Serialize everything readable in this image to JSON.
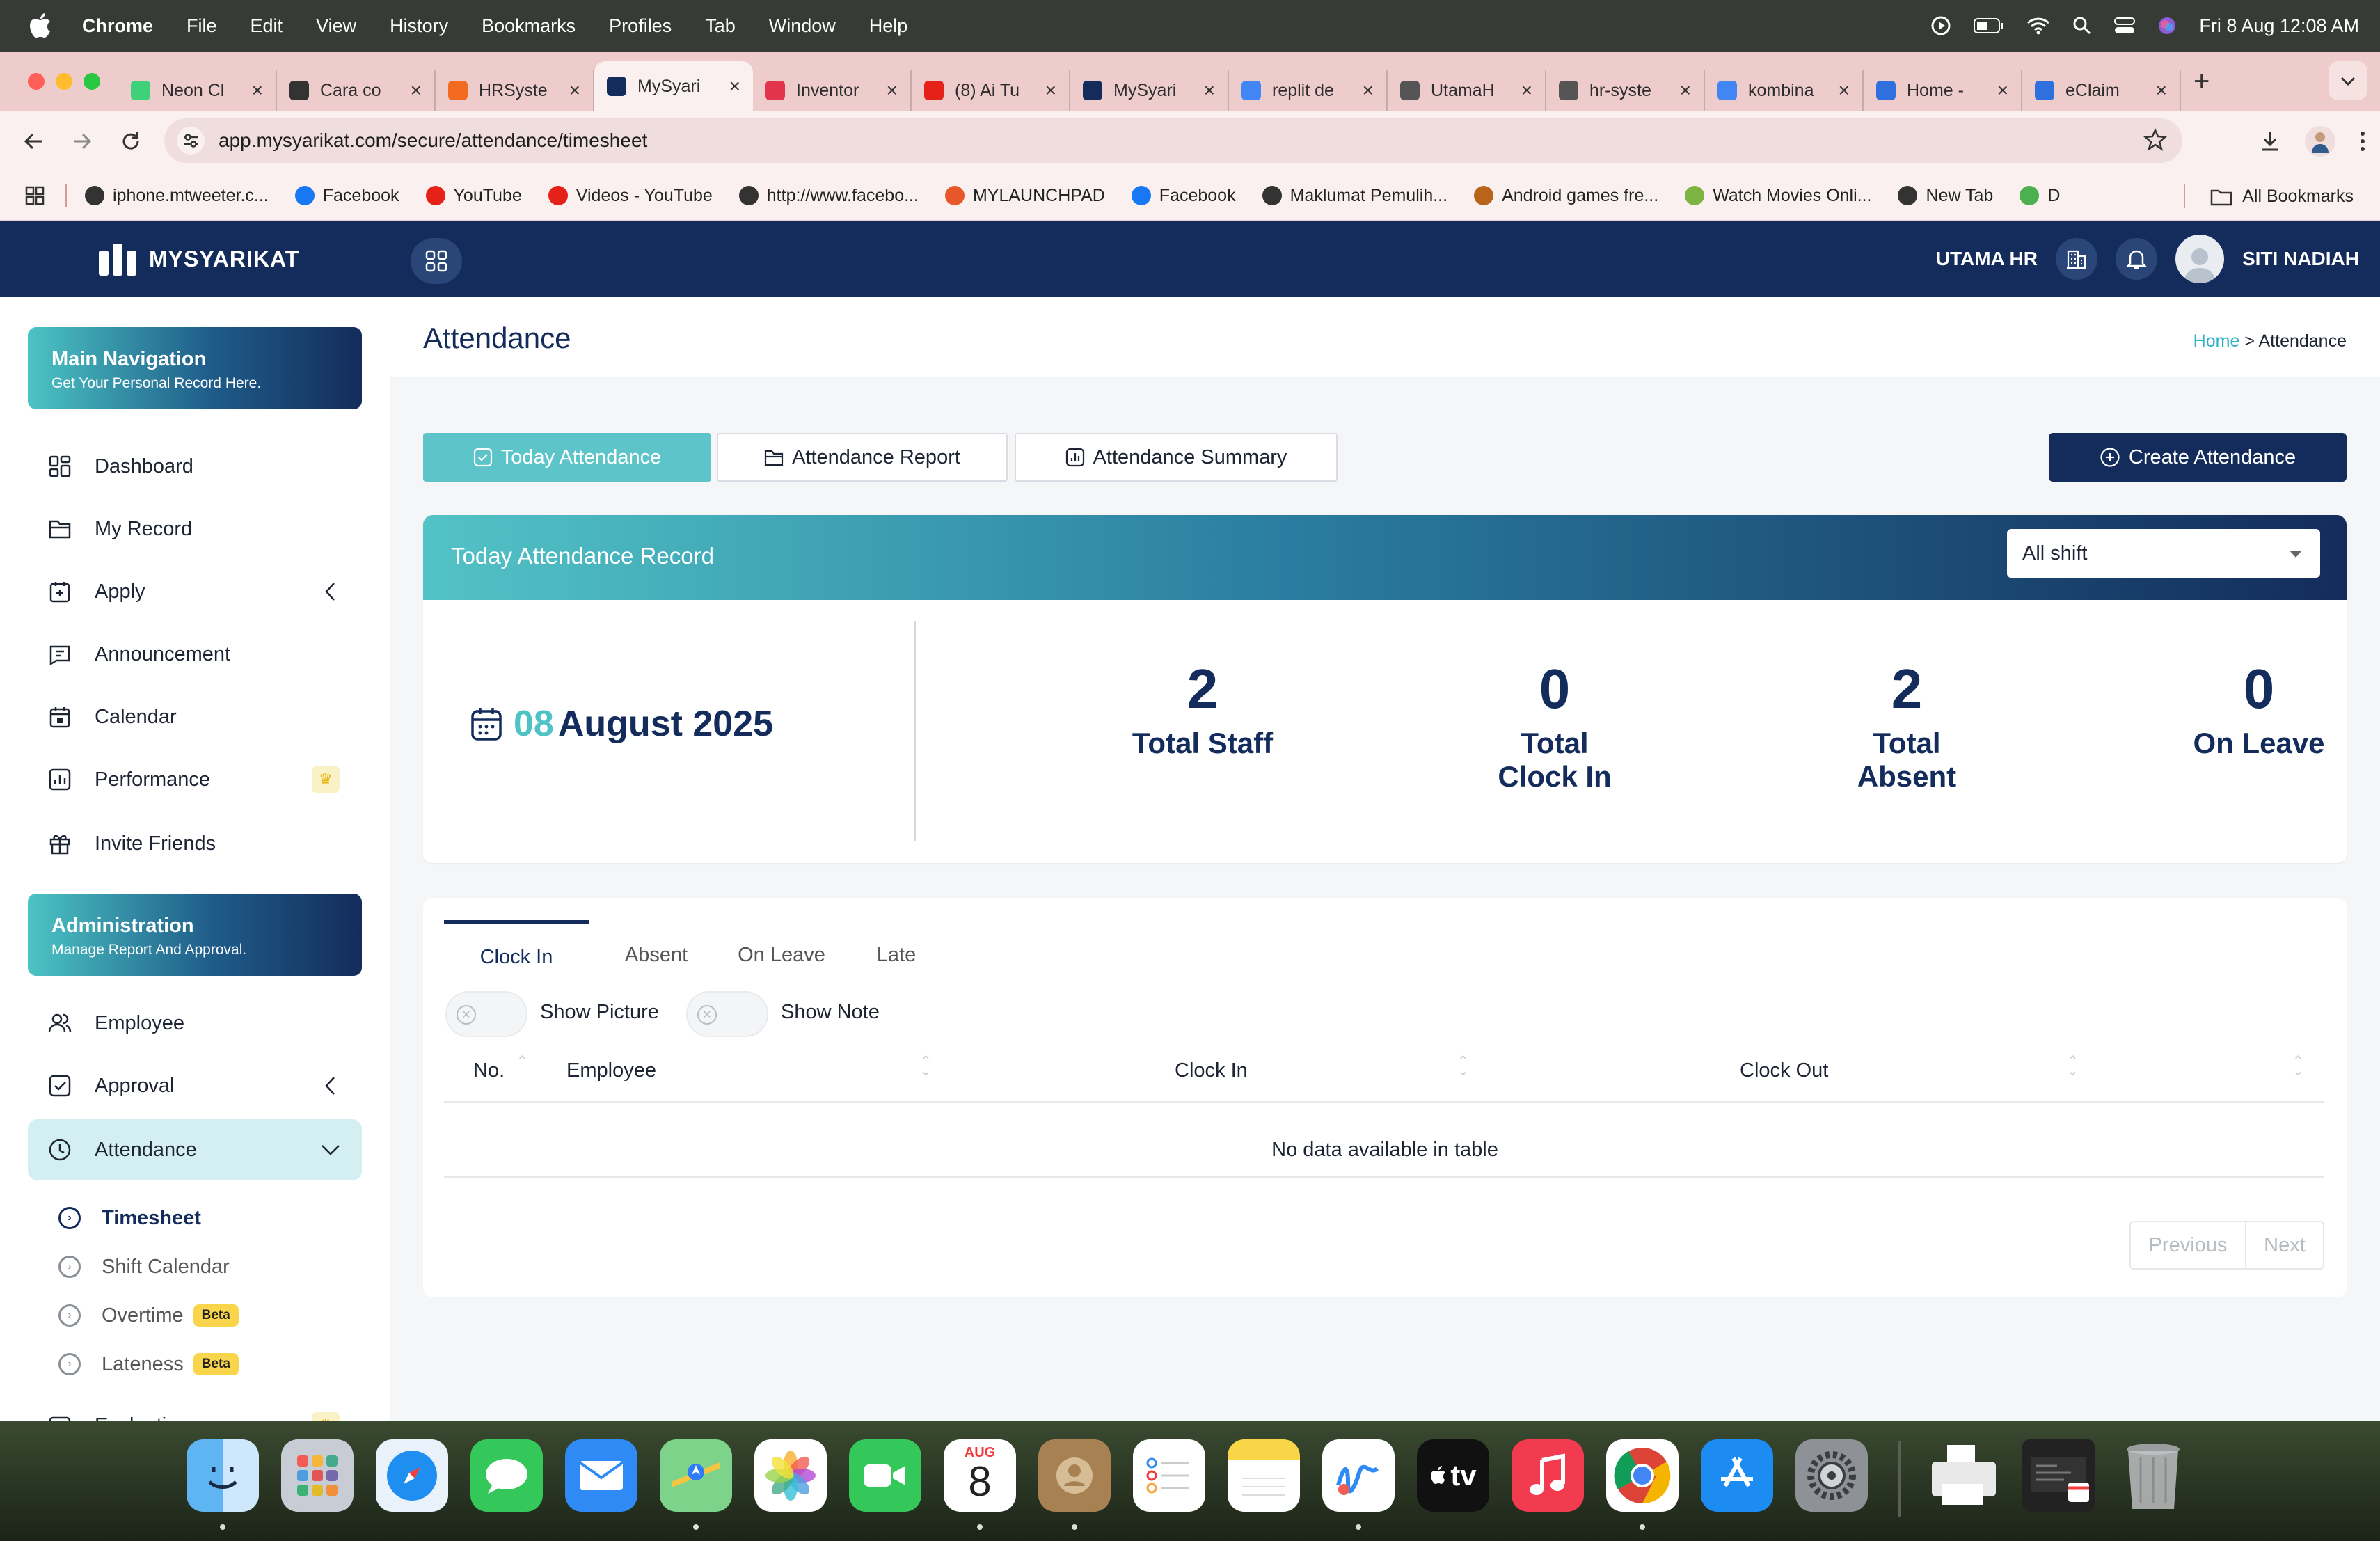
{
  "menubar": {
    "app": "Chrome",
    "menus": [
      "File",
      "Edit",
      "View",
      "History",
      "Bookmarks",
      "Profiles",
      "Tab",
      "Window",
      "Help"
    ],
    "clock": "Fri 8 Aug  12:08 AM"
  },
  "tabs": [
    {
      "title": "Neon Cl",
      "color": "#3fd17a"
    },
    {
      "title": "Cara co",
      "color": "#333333"
    },
    {
      "title": "HRSyste",
      "color": "#f36b21"
    },
    {
      "title": "MySyari",
      "color": "#132c5b",
      "active": true
    },
    {
      "title": "Inventor",
      "color": "#e2344b"
    },
    {
      "title": "(8) Ai Tu",
      "color": "#e62117"
    },
    {
      "title": "MySyari",
      "color": "#132c5b"
    },
    {
      "title": "replit de",
      "color": "#4285f4"
    },
    {
      "title": "UtamaH",
      "color": "#555555"
    },
    {
      "title": "hr-syste",
      "color": "#555555"
    },
    {
      "title": "kombina",
      "color": "#4285f4"
    },
    {
      "title": "Home -",
      "color": "#2f6fde"
    },
    {
      "title": "eClaim",
      "color": "#2f6fde"
    }
  ],
  "address": {
    "url": "app.mysyarikat.com/secure/attendance/timesheet"
  },
  "bookmarks": [
    {
      "label": "iphone.mtweeter.c...",
      "color": "#333333"
    },
    {
      "label": "Facebook",
      "color": "#1877f2"
    },
    {
      "label": "YouTube",
      "color": "#e62117"
    },
    {
      "label": "Videos - YouTube",
      "color": "#e62117"
    },
    {
      "label": "http://www.facebo...",
      "color": "#333333"
    },
    {
      "label": "MYLAUNCHPAD",
      "color": "#e8572a"
    },
    {
      "label": "Facebook",
      "color": "#1877f2"
    },
    {
      "label": "Maklumat Pemulih...",
      "color": "#333333"
    },
    {
      "label": "Android games fre...",
      "color": "#b8641a"
    },
    {
      "label": "Watch Movies Onli...",
      "color": "#7cb342"
    },
    {
      "label": "New Tab",
      "color": "#333333"
    },
    {
      "label": "D",
      "color": "#4caf50"
    }
  ],
  "all_bookmarks": "All Bookmarks",
  "app": {
    "logo": "MYSYARIKAT",
    "company": "UTAMA HR",
    "user": "SITI NADIAH"
  },
  "sidebar": {
    "main_nav": {
      "title": "Main Navigation",
      "subtitle": "Get Your Personal Record Here."
    },
    "items": [
      "Dashboard",
      "My Record",
      "Apply",
      "Announcement",
      "Calendar",
      "Performance",
      "Invite Friends"
    ],
    "admin": {
      "title": "Administration",
      "subtitle": "Manage Report And Approval."
    },
    "admin_items": [
      "Employee",
      "Approval",
      "Attendance"
    ],
    "sub_items": [
      "Timesheet",
      "Shift Calendar",
      "Overtime",
      "Lateness"
    ],
    "beta": "Beta",
    "cut_item": "Evaluation"
  },
  "page": {
    "title": "Attendance",
    "crumb_home": "Home",
    "crumb_sep": ">",
    "crumb_current": "Attendance"
  },
  "toolbar": {
    "today": "Today Attendance",
    "report": "Attendance Report",
    "summary": "Attendance Summary",
    "create": "Create Attendance"
  },
  "record": {
    "title": "Today Attendance Record",
    "shift": "All shift",
    "date_day": "08",
    "date_rest": "August 2025",
    "stats": [
      {
        "value": "2",
        "label": "Total Staff"
      },
      {
        "value": "0",
        "label": "Total Clock In"
      },
      {
        "value": "2",
        "label": "Total Absent"
      },
      {
        "value": "0",
        "label": "On Leave"
      }
    ]
  },
  "table": {
    "tabs": [
      "Clock In",
      "Absent",
      "On Leave",
      "Late"
    ],
    "toggles": [
      "Show Picture",
      "Show Note"
    ],
    "columns": [
      "No.",
      "Employee",
      "Clock In",
      "Clock Out"
    ],
    "empty": "No data available in table",
    "prev": "Previous",
    "next": "Next"
  },
  "dock": {
    "calendar_month": "AUG",
    "calendar_day": "8",
    "tv_label": "tv"
  }
}
